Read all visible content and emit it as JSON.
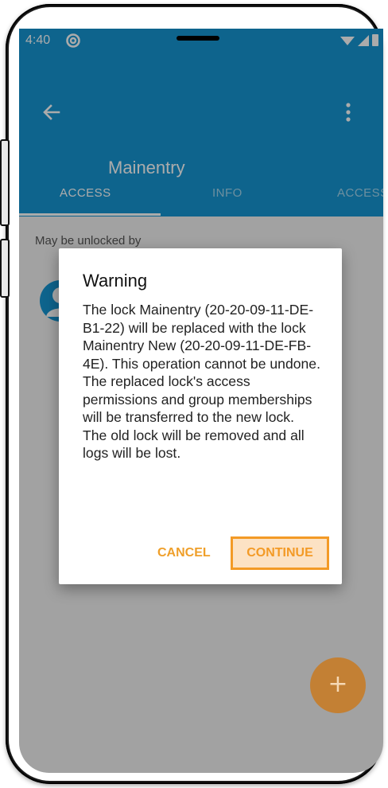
{
  "status_bar": {
    "time": "4:40",
    "notification_icon": "at-sign-icon",
    "icons": [
      "wifi-icon",
      "signal-icon",
      "battery-icon"
    ]
  },
  "app_bar": {
    "title": "Mainentry",
    "back_icon": "arrow-left-icon",
    "menu_icon": "more-vertical-icon",
    "tabs": [
      {
        "label": "ACCESS",
        "selected": true
      },
      {
        "label": "INFO",
        "selected": false
      },
      {
        "label": "ACCESS",
        "selected": false
      }
    ]
  },
  "content": {
    "section_label": "May be unlocked by",
    "avatar_icon": "user-avatar-icon"
  },
  "dialog": {
    "title": "Warning",
    "message": "The lock Mainentry (20-20-09-11-DE-B1-22) will be replaced with the lock Mainentry New (20-20-09-11-DE-FB-4E). This operation cannot be undone. The replaced lock's access permissions and group memberships will be transferred to the new lock. The old lock will be removed and all logs will be lost.",
    "cancel_label": "CANCEL",
    "continue_label": "CONTINUE"
  },
  "fab": {
    "label": "+",
    "icon": "plus-icon"
  },
  "colors": {
    "primary": "#1596d3",
    "accent": "#f39a26",
    "fab": "#c38034"
  }
}
